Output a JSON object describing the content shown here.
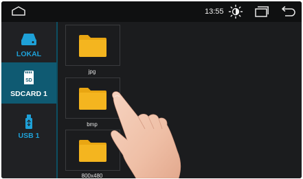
{
  "status": {
    "time": "13:55"
  },
  "icons": {
    "home": "home-icon",
    "brightness": "brightness-icon",
    "recent": "recent-apps-icon",
    "back": "back-icon",
    "local": "hard-drive-icon",
    "sdcard": "sd-card-icon",
    "usb": "usb-drive-icon",
    "folder": "folder-icon"
  },
  "colors": {
    "accent": "#1ea1d8",
    "active_bg": "#0f5a72",
    "folder": "#f2b21c",
    "background": "#1b1c1e"
  },
  "sidebar": {
    "items": [
      {
        "label": "LOKAL",
        "active": false
      },
      {
        "label": "SDCARD 1",
        "active": true
      },
      {
        "label": "USB 1",
        "active": false
      }
    ]
  },
  "folders": [
    {
      "name": "jpg"
    },
    {
      "name": "bmp"
    },
    {
      "name": "800x480"
    }
  ]
}
